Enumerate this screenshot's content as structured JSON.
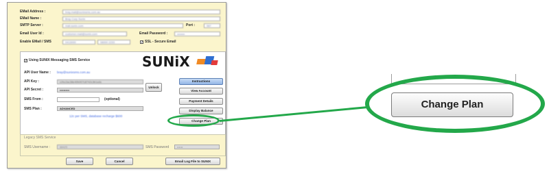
{
  "email": {
    "address_label": "EMail Address :",
    "address_value": "bray.mail@sunixsms.com.au",
    "name_label": "EMail Name :",
    "name_value": "Bray Corp Sunix",
    "smtp_label": "SMTP Server :",
    "smtp_value": "mail.sunix.com",
    "port_label": "Port :",
    "port_value": "587",
    "user_id_label": "Email User Id :",
    "user_id_value": "customer.mail@sunix.com",
    "password_label": "Email Password :",
    "password_value": "••••••••",
    "enable_label": "Enable EMail / SMS",
    "enable_value_1": "0413000",
    "enable_value_2": "08000 2233",
    "ssl_label": "SSL - Secure Email",
    "ssl_checked": true
  },
  "sms": {
    "use_label": "Using SUNIX Messaging SMS Service",
    "use_checked": true,
    "logo_text": "SUNiX",
    "api_user_label": "API User Name :",
    "api_user_value": "bray@sunixsms.com.au",
    "api_key_label": "API Key :",
    "api_key_value": "c2bc2ac38e40b007c8742c3b1a3c",
    "api_secret_label": "API Secret :",
    "api_secret_value": "••••••••••",
    "unlock_label": "Unlock",
    "sms_from_label": "SMS From :",
    "sms_from_value": "",
    "optional_label": "(optional)",
    "sms_plan_label": "SMS Plan :",
    "sms_plan_value": "ADVANCED",
    "plan_note": "12c per SMS, database recharge $600",
    "buttons": {
      "instructions": "Instructions",
      "view_account": "View Account",
      "payment_details": "Payment Details",
      "display_balance": "Display Balance",
      "change_plan": "Change Plan"
    }
  },
  "legacy": {
    "title": "Legacy SMS Service",
    "username_label": "SMS Username :",
    "username_value": "88425",
    "password_label": "SMS Password",
    "password_value": "••••••"
  },
  "footer": {
    "save": "Save",
    "cancel": "Cancel",
    "email_log": "Email Log File to SUNIX"
  },
  "callout": {
    "change_plan": "Change Plan"
  },
  "colors": {
    "highlight": "#23a84a",
    "dialog_bg": "#fbf5cc",
    "logo_orange": "#f08a24",
    "logo_blue": "#2f6fd1",
    "logo_red": "#e23b3b"
  }
}
